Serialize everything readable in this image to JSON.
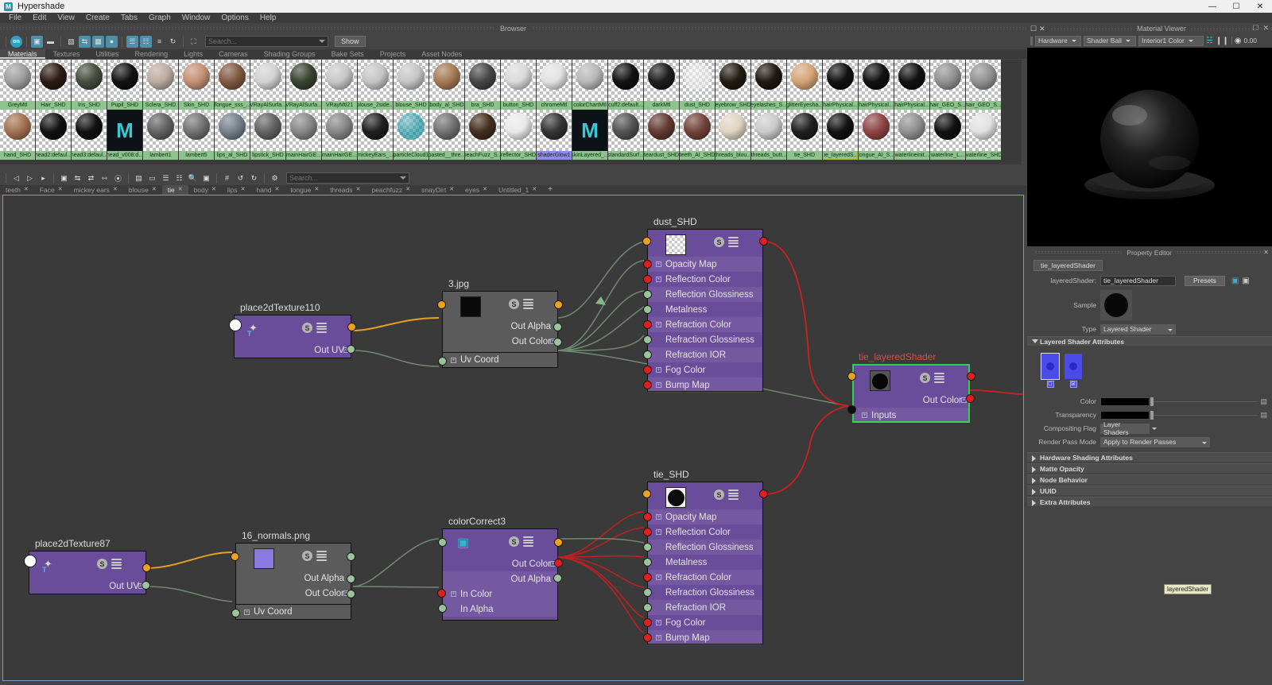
{
  "window": {
    "title": "Hypershade",
    "logo": "M",
    "controls": [
      "minimize",
      "maximize",
      "close"
    ]
  },
  "menubar": {
    "items": [
      "File",
      "Edit",
      "View",
      "Create",
      "Tabs",
      "Graph",
      "Window",
      "Options",
      "Help"
    ]
  },
  "browser": {
    "panel_title": "Browser",
    "toolbar_search_placeholder": "Search...",
    "show_button": "Show",
    "category_tabs": [
      "Materials",
      "Textures",
      "Utilities",
      "Rendering",
      "Lights",
      "Cameras",
      "Shading Groups",
      "Bake Sets",
      "Projects",
      "Asset Nodes"
    ],
    "active_category": "Materials",
    "row1": [
      {
        "name": "GreyMtl",
        "color": "#9a9a9a",
        "kind": "ball"
      },
      {
        "name": "Hair_SHD",
        "color": "#201008",
        "kind": "ball"
      },
      {
        "name": "Iris_SHD",
        "color": "#3a4434",
        "kind": "ball"
      },
      {
        "name": "Pupil_SHD",
        "color": "#050505",
        "kind": "ball"
      },
      {
        "name": "Sclera_SHD",
        "color": "#b8a79c",
        "kind": "ball"
      },
      {
        "name": "Skin_SHD",
        "color": "#c08a6e",
        "kind": "ball"
      },
      {
        "name": "Tongue_sss_...",
        "color": "#7a5038",
        "kind": "ball"
      },
      {
        "name": "VRayAlSurfa...",
        "color": "#cfcfcf",
        "kind": "ball"
      },
      {
        "name": "VRayAlSurfa...",
        "color": "#2e3a26",
        "kind": "ball"
      },
      {
        "name": "VRayMtl21",
        "color": "#c4c4c4",
        "kind": "ball"
      },
      {
        "name": "blouse_2side...",
        "color": "#c2c2c2",
        "kind": "ball"
      },
      {
        "name": "blouse_SHD",
        "color": "#c2c2c2",
        "kind": "ball"
      },
      {
        "name": "body_al_SHD",
        "color": "#a0744c",
        "kind": "ball"
      },
      {
        "name": "bra_SHD",
        "color": "#3c3c3c",
        "kind": "ball"
      },
      {
        "name": "button_SHD",
        "color": "#d8d8d8",
        "kind": "ball"
      },
      {
        "name": "chromeMtl",
        "color": "#e0e0e0",
        "kind": "ball"
      },
      {
        "name": "colorChartMtl",
        "color": "#b4b4b4",
        "kind": "ball"
      },
      {
        "name": "cuff2:default...",
        "color": "#060606",
        "kind": "ball"
      },
      {
        "name": "darkMtl",
        "color": "#121212",
        "kind": "ball"
      },
      {
        "name": "dust_SHD",
        "color": "#e8e8e8",
        "kind": "checker"
      },
      {
        "name": "eyebrow_SHD",
        "color": "#181008",
        "kind": "ball"
      },
      {
        "name": "eyelashes_S...",
        "color": "#140c06",
        "kind": "ball"
      },
      {
        "name": "glitterEyesha...",
        "color": "#d2a070",
        "kind": "ball"
      },
      {
        "name": "hairPhysical...",
        "color": "#050505",
        "kind": "ball"
      },
      {
        "name": "hairPhysical...",
        "color": "#050505",
        "kind": "ball"
      },
      {
        "name": "hairPhysical...",
        "color": "#050505",
        "kind": "ball"
      },
      {
        "name": "hair_GEO_S...",
        "color": "#8c8c8c",
        "kind": "ball"
      },
      {
        "name": "hair_GEO_S...",
        "color": "#8c8c8c",
        "kind": "ball"
      }
    ],
    "row2": [
      {
        "name": "hand_SHD",
        "color": "#9e6a48",
        "kind": "ball"
      },
      {
        "name": "head2:defaul...",
        "color": "#050505",
        "kind": "ball"
      },
      {
        "name": "head3:defaul...",
        "color": "#050505",
        "kind": "ball"
      },
      {
        "name": "head_v008:d...",
        "color": "#0c1215",
        "kind": "maya"
      },
      {
        "name": "lambert1",
        "color": "#5a5a5a",
        "kind": "ball"
      },
      {
        "name": "lambert5",
        "color": "#6a6a6a",
        "kind": "ball"
      },
      {
        "name": "lips_al_SHD",
        "color": "#6e7a84",
        "kind": "ball"
      },
      {
        "name": "lipstick_SHD",
        "color": "#5a5a5a",
        "kind": "ball"
      },
      {
        "name": "mainHairGE...",
        "color": "#808080",
        "kind": "ball"
      },
      {
        "name": "mainHairGE...",
        "color": "#808080",
        "kind": "ball"
      },
      {
        "name": "mickeyEars_...",
        "color": "#141414",
        "kind": "ball"
      },
      {
        "name": "particleCloud1",
        "color": "#0c8c9c",
        "kind": "checker"
      },
      {
        "name": "pasted__thre...",
        "color": "#6a6a6a",
        "kind": "ball"
      },
      {
        "name": "peachFuzz_S...",
        "color": "#3a2414",
        "kind": "ball"
      },
      {
        "name": "reflector_SHD",
        "color": "#e8e8e8",
        "kind": "ball"
      },
      {
        "name": "shaderGlow1",
        "color": "#2a2a2a",
        "kind": "ball",
        "selected": true
      },
      {
        "name": "skinLayered_...",
        "color": "#0c1215",
        "kind": "maya"
      },
      {
        "name": "standardSurf...",
        "color": "#4a4a4a",
        "kind": "ball"
      },
      {
        "name": "teardust_SHD",
        "color": "#5a3028",
        "kind": "ball"
      },
      {
        "name": "teeth_AI_SHD",
        "color": "#6a3a30",
        "kind": "ball"
      },
      {
        "name": "threads_blou...",
        "color": "#ded2c0",
        "kind": "ball"
      },
      {
        "name": "threads_butt...",
        "color": "#c8c8c8",
        "kind": "ball"
      },
      {
        "name": "tie_SHD",
        "color": "#141414",
        "kind": "ball"
      },
      {
        "name": "tie_layeredS...",
        "color": "#060606",
        "kind": "ball",
        "highlight": true
      },
      {
        "name": "tongue_AI_S...",
        "color": "#8a3a3a",
        "kind": "ball"
      },
      {
        "name": "waterlineinit...",
        "color": "#8a8a8a",
        "kind": "ball"
      },
      {
        "name": "waterline_L...",
        "color": "#050505",
        "kind": "ball"
      },
      {
        "name": "waterline_SHD",
        "color": "#e0e0e0",
        "kind": "ball"
      }
    ]
  },
  "graph": {
    "toolbar_search_placeholder": "Search...",
    "tabs": [
      {
        "label": "teeth",
        "active": false
      },
      {
        "label": "Face",
        "active": false
      },
      {
        "label": "mickey ears",
        "active": false
      },
      {
        "label": "blouse",
        "active": false
      },
      {
        "label": "tie",
        "active": true
      },
      {
        "label": "body",
        "active": false
      },
      {
        "label": "lips",
        "active": false
      },
      {
        "label": "hand",
        "active": false
      },
      {
        "label": "tongue",
        "active": false
      },
      {
        "label": "threads",
        "active": false
      },
      {
        "label": "peachfuzz",
        "active": false
      },
      {
        "label": "snayDirt",
        "active": false
      },
      {
        "label": "eyes",
        "active": false
      },
      {
        "label": "Untitled_1",
        "active": false
      }
    ],
    "add_tab": "+",
    "nodes": {
      "place2dTexture110": {
        "title": "place2dTexture110",
        "out_label": "Out UV"
      },
      "texture3jpg": {
        "title": "3.jpg",
        "out_alpha": "Out Alpha",
        "out_color": "Out Color",
        "uv_coord": "Uv Coord"
      },
      "dust_SHD": {
        "title": "dust_SHD",
        "ports": [
          "Opacity Map",
          "Reflection Color",
          "Reflection Glossiness",
          "Metalness",
          "Refraction Color",
          "Refraction Glossiness",
          "Refraction IOR",
          "Fog Color",
          "Bump Map"
        ]
      },
      "tie_layeredShader": {
        "title": "tie_layeredShader",
        "out_color": "Out Color",
        "inputs": "Inputs"
      },
      "place2dTexture87": {
        "title": "place2dTexture87",
        "out_label": "Out UV"
      },
      "normals16png": {
        "title": "16_normals.png",
        "out_alpha": "Out Alpha",
        "out_color": "Out Color",
        "uv_coord": "Uv Coord"
      },
      "colorCorrect3": {
        "title": "colorCorrect3",
        "out_color": "Out Color",
        "out_alpha": "Out Alpha",
        "in_color": "In Color",
        "in_alpha": "In Alpha"
      },
      "tie_SHD": {
        "title": "tie_SHD",
        "ports": [
          "Opacity Map",
          "Reflection Color",
          "Reflection Glossiness",
          "Metalness",
          "Refraction Color",
          "Refraction Glossiness",
          "Refraction IOR",
          "Fog Color",
          "Bump Map"
        ]
      }
    }
  },
  "material_viewer": {
    "panel_title": "Material Viewer",
    "renderer": "Hardware",
    "geometry": "Shader Ball",
    "environment": "Interior1 Color",
    "time_value": "0.00"
  },
  "property_editor": {
    "panel_title": "Property Editor",
    "node_tab": "tie_layeredShader",
    "fields": {
      "layered_shader_label": "layeredShader:",
      "layered_shader_value": "tie_layeredShader",
      "presets_button": "Presets",
      "sample_label": "Sample",
      "type_label": "Type",
      "type_value": "Layered Shader"
    },
    "sections": [
      {
        "label": "Layered Shader Attributes",
        "open": true
      },
      {
        "label": "Hardware Shading Attributes",
        "open": false
      },
      {
        "label": "Matte Opacity",
        "open": false
      },
      {
        "label": "Node Behavior",
        "open": false
      },
      {
        "label": "UUID",
        "open": false
      },
      {
        "label": "Extra Attributes",
        "open": false
      }
    ],
    "attributes": {
      "color_label": "Color",
      "transparency_label": "Transparency",
      "compositing_flag_label": "Compositing Flag",
      "compositing_flag_value": "Layer Shaders",
      "render_pass_mode_label": "Render Pass Mode",
      "render_pass_mode_value": "Apply to Render Passes"
    }
  },
  "tooltip": {
    "text": "layeredShader"
  },
  "colors": {
    "node_purple": "#6a4d9a",
    "node_grey": "#5b5b5b",
    "selection_green": "#2fd14a",
    "port_red": "#e02020",
    "port_green": "#9cc49c",
    "port_orange": "#f0a020",
    "accent_blue": "#4d8fa8"
  }
}
